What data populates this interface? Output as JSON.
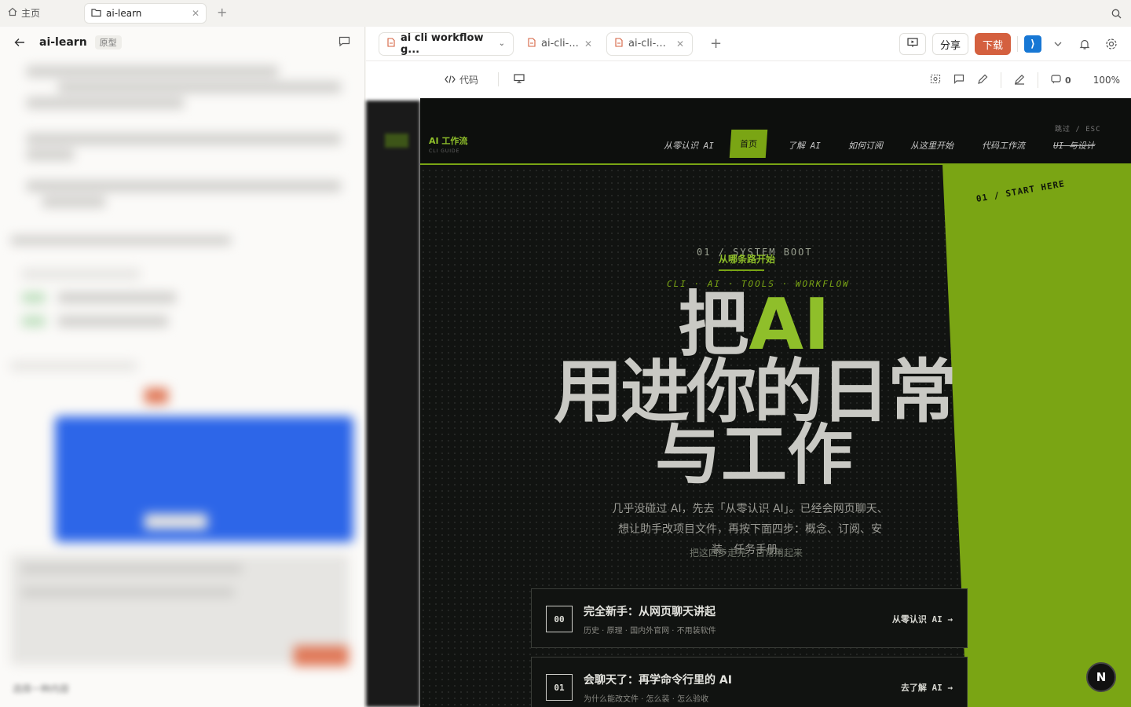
{
  "topbar": {
    "home_label": "主页",
    "tab_label": "ai-learn"
  },
  "left": {
    "title": "ai-learn",
    "badge": "原型",
    "footer": "选择一种内容"
  },
  "doc_tabs": [
    {
      "label": "ai cli workflow g..."
    },
    {
      "label": "ai-cli-..."
    },
    {
      "label": "ai-cli-..."
    }
  ],
  "actions": {
    "share": "分享",
    "download": "下载"
  },
  "toolbar": {
    "code": "代码",
    "comments_count": "0",
    "zoom": "100%"
  },
  "site": {
    "brand": "AI 工作流",
    "brand_sub": "CLI GUIDE",
    "nav": [
      "从零认识 AI",
      "首页",
      "了解 AI",
      "如何订阅",
      "从这里开始",
      "代码工作流",
      "UI 与设计"
    ],
    "skip": "跳过 / ESC",
    "start_here": "01 / START HERE",
    "boot": "01 / SYSTEM BOOT",
    "boot_cn": "从哪条路开始",
    "tags": "CLI · AI · TOOLS · WORKFLOW",
    "hero_l1a": "把",
    "hero_l1b": "AI",
    "hero_l2": "用进你的日常",
    "hero_l3": "与工作",
    "intro": "几乎没碰过 AI，先去「从零认识 AI」。已经会网页聊天、想让助手改项目文件，再按下面四步：概念、订阅、安装、任务手册。",
    "overlay": "把这四步走完，日常用起来",
    "cards": [
      {
        "num": "00",
        "title": "完全新手：从网页聊天讲起",
        "sub": "历史 · 原理 · 国内外官网 · 不用装软件",
        "go": "从零认识 AI →"
      },
      {
        "num": "01",
        "title": "会聊天了：再学命令行里的 AI",
        "sub": "为什么能改文件 · 怎么装 · 怎么验收",
        "go": "去了解 AI →"
      }
    ],
    "n_button": "N"
  }
}
